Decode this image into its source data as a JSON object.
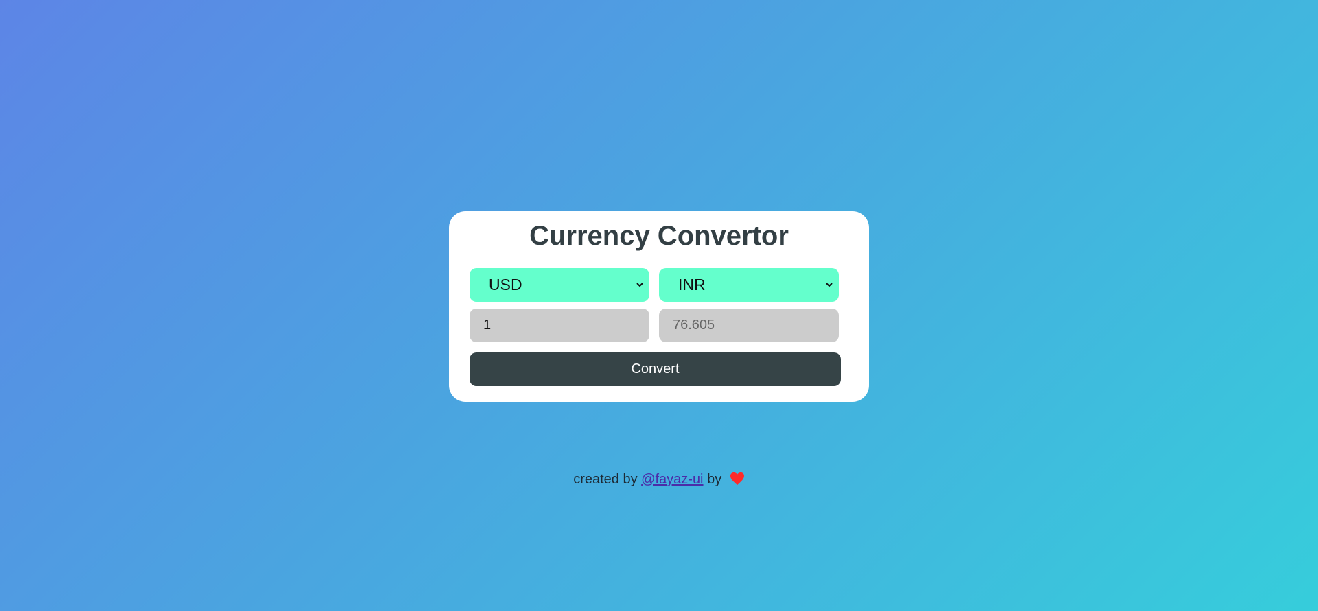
{
  "title": "Currency Convertor",
  "from_currency": {
    "selected": "USD"
  },
  "to_currency": {
    "selected": "INR"
  },
  "amount_input": {
    "value": "1"
  },
  "result_input": {
    "placeholder": "76.605"
  },
  "convert_button": {
    "label": "Convert"
  },
  "footer": {
    "prefix": "created by",
    "link_text": "@fayaz-ui",
    "suffix": "by",
    "icon": "heart-icon"
  },
  "colors": {
    "select_bg": "#64ffcc",
    "input_bg": "#cccccc",
    "button_bg": "#364447",
    "title": "#333f44",
    "heart": "#ff2a2a",
    "gradient_start": "#5d85e6",
    "gradient_end": "#36cddb"
  }
}
